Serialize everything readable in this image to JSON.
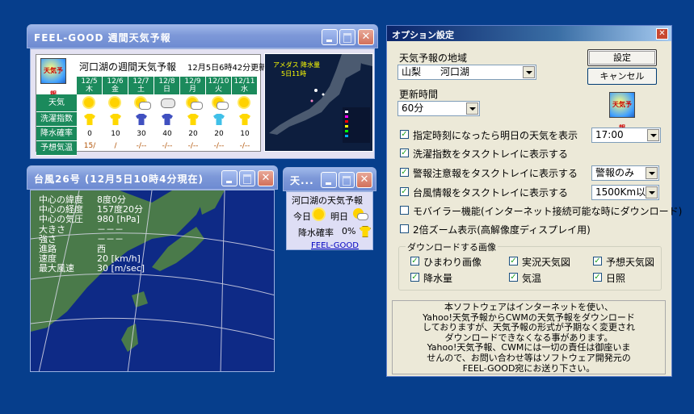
{
  "forecast_window": {
    "title": "FEEL-GOOD 週間天気予報",
    "heading": "河口湖の週間天気予報",
    "updated": "12月5日6時42分更新",
    "logo_text": "天気予報",
    "row_labels": [
      "天気",
      "洗濯指数",
      "降水確率",
      "予想気温"
    ],
    "days": [
      {
        "date": "12/5",
        "dow": "木",
        "weather": "sun",
        "laundry": "shirt-yellow",
        "rain": "0",
        "temp": "15/"
      },
      {
        "date": "12/6",
        "dow": "金",
        "weather": "sun",
        "laundry": "shirt-yellow",
        "rain": "10",
        "temp": "/"
      },
      {
        "date": "12/7",
        "dow": "土",
        "weather": "sun-cloud",
        "laundry": "shirt-blue",
        "rain": "30",
        "temp": "-/--"
      },
      {
        "date": "12/8",
        "dow": "日",
        "weather": "cloud",
        "laundry": "shirt-blue",
        "rain": "40",
        "temp": "-/--"
      },
      {
        "date": "12/9",
        "dow": "月",
        "weather": "sun-cloud",
        "laundry": "shirt-yellow",
        "rain": "20",
        "temp": "-/--"
      },
      {
        "date": "12/10",
        "dow": "火",
        "weather": "sun-cloud",
        "laundry": "shirt-cyan",
        "rain": "20",
        "temp": "-/--"
      },
      {
        "date": "12/11",
        "dow": "水",
        "weather": "sun",
        "laundry": "shirt-yellow",
        "rain": "10",
        "temp": "-/--"
      }
    ],
    "amedas_label": "アメダス 降水量",
    "amedas_time": "5日11時"
  },
  "typhoon_window": {
    "title": "台風26号 (12月5日10時4分現在)",
    "rows": [
      {
        "label": "中心の緯度",
        "value": "8度0分"
      },
      {
        "label": "中心の経度",
        "value": "157度20分"
      },
      {
        "label": "中心の気圧",
        "value": "980 [hPa]"
      },
      {
        "label": "大きさ",
        "value": "－－－"
      },
      {
        "label": "強さ",
        "value": "－－－"
      },
      {
        "label": "進路",
        "value": "西"
      },
      {
        "label": "速度",
        "value": "20 [km/h]"
      },
      {
        "label": "最大風速",
        "value": "30 [m/sec]"
      }
    ]
  },
  "mini_window": {
    "title": "天...",
    "heading": "河口湖の天気予報",
    "today_label": "今日",
    "tomorrow_label": "明日",
    "rain_label": "降水確率",
    "rain_value": "0%",
    "link": "FEEL-GOOD"
  },
  "options_dialog": {
    "title": "オプション設定",
    "region_label": "天気予報の地域",
    "region_value": "山梨　　河口湖",
    "update_label": "更新時間",
    "update_value": "60分",
    "ok_label": "設定",
    "cancel_label": "キャンセル",
    "logo_text": "天気予報",
    "options": [
      {
        "label": "指定時刻になったら明日の天気を表示",
        "checked": true,
        "select": "17:00"
      },
      {
        "label": "洗濯指数をタスクトレイに表示する",
        "checked": true,
        "select": null
      },
      {
        "label": "警報注意報をタスクトレイに表示する",
        "checked": true,
        "select": "警報のみ"
      },
      {
        "label": "台風情報をタスクトレイに表示する",
        "checked": true,
        "select": "1500Km以内"
      },
      {
        "label": "モバイラー機能(インターネット接続可能な時にダウンロード)",
        "checked": false,
        "select": null
      },
      {
        "label": "2倍ズーム表示(高解像度ディスプレイ用)",
        "checked": false,
        "select": null
      }
    ],
    "download_group_title": "ダウンロードする画像",
    "download_items": [
      {
        "label": "ひまわり画像",
        "checked": true
      },
      {
        "label": "実況天気図",
        "checked": true
      },
      {
        "label": "予想天気図",
        "checked": true
      },
      {
        "label": "降水量",
        "checked": true
      },
      {
        "label": "気温",
        "checked": true
      },
      {
        "label": "日照",
        "checked": true
      }
    ],
    "notice_lines": [
      "本ソフトウェアはインターネットを使い、",
      "Yahoo!天気予報からCWMの天気予報をダウンロード",
      "しておりますが、天気予報の形式が予期なく変更され",
      "ダウンロードできなくなる事があります。",
      "Yahoo!天気予報、CWMには一切の責任は御座いま",
      "せんので、お問い合わせ等はソフトウェア開発元の",
      "FEEL-GOOD宛にお送り下さい。"
    ]
  },
  "colors": {
    "desktop": "#063e8c",
    "forecast_header": "#1b8a5c",
    "grid_blue": "#1a3a9a"
  }
}
